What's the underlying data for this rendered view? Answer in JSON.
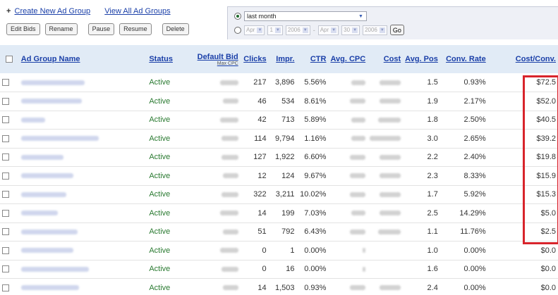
{
  "toolbar": {
    "create_link": "Create New Ad Group",
    "view_link": "View All Ad Groups",
    "buttons": [
      "Edit Bids",
      "Rename",
      "Pause",
      "Resume",
      "Delete"
    ]
  },
  "date_panel": {
    "preset_value": "last month",
    "range_from_month": "Apr",
    "range_from_day": "1",
    "range_from_year": "2006",
    "range_to_month": "Apr",
    "range_to_day": "30",
    "range_to_year": "2006",
    "go_label": "Go"
  },
  "table": {
    "headers": {
      "name": "Ad Group Name",
      "status": "Status",
      "default_bid": "Default Bid",
      "default_bid_sub": "Max CPC",
      "clicks": "Clicks",
      "impr": "Impr.",
      "ctr": "CTR",
      "avg_cpc": "Avg. CPC",
      "cost": "Cost",
      "avg_pos": "Avg. Pos",
      "conv_rate": "Conv. Rate",
      "cost_conv": "Cost/Conv."
    },
    "rows": [
      {
        "status": "Active",
        "clicks": "217",
        "impr": "3,896",
        "ctr": "5.56%",
        "avg_pos": "1.5",
        "conv_rate": "0.93%",
        "cost_conv": "$72.5"
      },
      {
        "status": "Active",
        "clicks": "46",
        "impr": "534",
        "ctr": "8.61%",
        "avg_pos": "1.9",
        "conv_rate": "2.17%",
        "cost_conv": "$52.0"
      },
      {
        "status": "Active",
        "clicks": "42",
        "impr": "713",
        "ctr": "5.89%",
        "avg_pos": "1.8",
        "conv_rate": "2.50%",
        "cost_conv": "$40.5"
      },
      {
        "status": "Active",
        "clicks": "114",
        "impr": "9,794",
        "ctr": "1.16%",
        "avg_pos": "3.0",
        "conv_rate": "2.65%",
        "cost_conv": "$39.2"
      },
      {
        "status": "Active",
        "clicks": "127",
        "impr": "1,922",
        "ctr": "6.60%",
        "avg_pos": "2.2",
        "conv_rate": "2.40%",
        "cost_conv": "$19.8"
      },
      {
        "status": "Active",
        "clicks": "12",
        "impr": "124",
        "ctr": "9.67%",
        "avg_pos": "2.3",
        "conv_rate": "8.33%",
        "cost_conv": "$15.9"
      },
      {
        "status": "Active",
        "clicks": "322",
        "impr": "3,211",
        "ctr": "10.02%",
        "avg_pos": "1.7",
        "conv_rate": "5.92%",
        "cost_conv": "$15.3"
      },
      {
        "status": "Active",
        "clicks": "14",
        "impr": "199",
        "ctr": "7.03%",
        "avg_pos": "2.5",
        "conv_rate": "14.29%",
        "cost_conv": "$5.0"
      },
      {
        "status": "Active",
        "clicks": "51",
        "impr": "792",
        "ctr": "6.43%",
        "avg_pos": "1.1",
        "conv_rate": "11.76%",
        "cost_conv": "$2.5"
      },
      {
        "status": "Active",
        "clicks": "0",
        "impr": "1",
        "ctr": "0.00%",
        "avg_pos": "1.0",
        "conv_rate": "0.00%",
        "cost_conv": "$0.0"
      },
      {
        "status": "Active",
        "clicks": "0",
        "impr": "16",
        "ctr": "0.00%",
        "avg_pos": "1.6",
        "conv_rate": "0.00%",
        "cost_conv": "$0.0"
      },
      {
        "status": "Active",
        "clicks": "14",
        "impr": "1,503",
        "ctr": "0.93%",
        "avg_pos": "2.4",
        "conv_rate": "0.00%",
        "cost_conv": "$0.0"
      }
    ]
  },
  "colors": {
    "link": "#1a3fa8",
    "status_active": "#2a7a31",
    "header_bg": "#e1ebf6",
    "highlight": "#d8242b"
  }
}
